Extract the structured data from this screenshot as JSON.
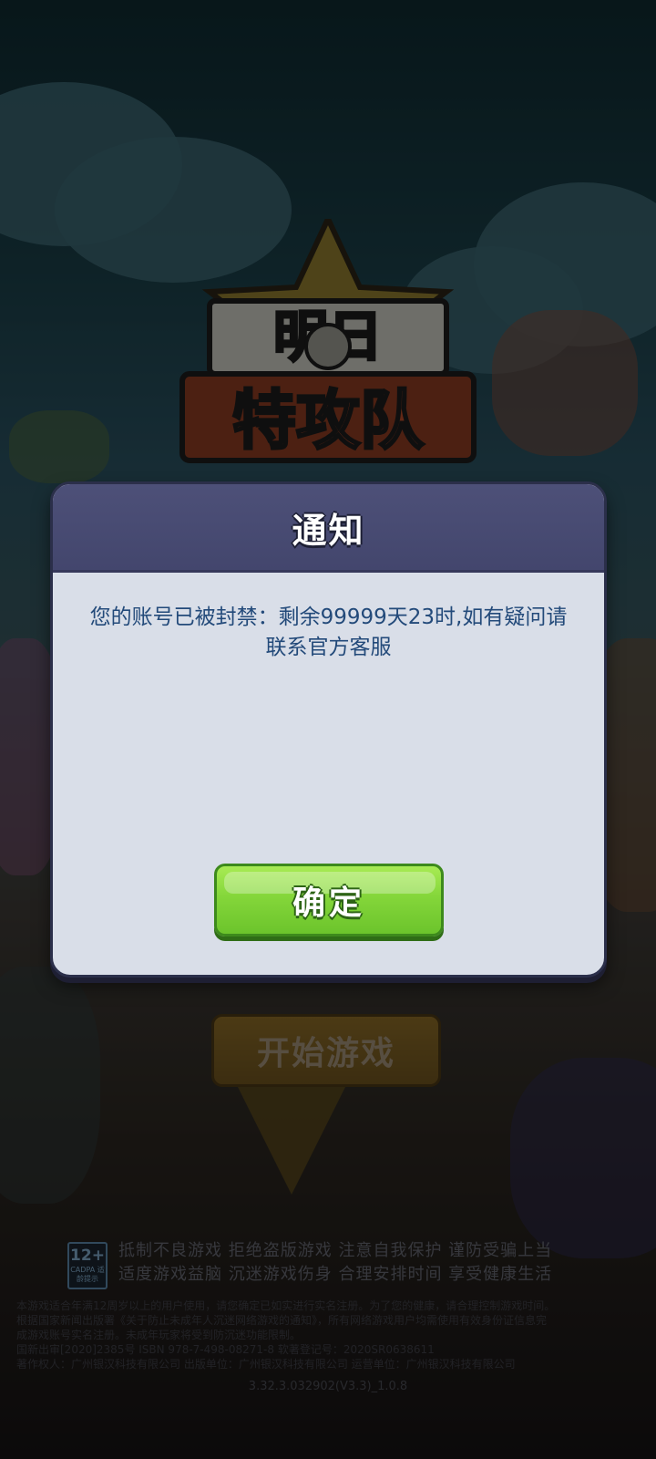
{
  "game": {
    "logo_text_top": "明日",
    "logo_text_bottom": "特攻队",
    "start_button_label": "开始游戏"
  },
  "modal": {
    "title": "通知",
    "message": "您的账号已被封禁：剩余99999天23时,如有疑问请联系官方客服",
    "confirm_label": "确定"
  },
  "footer": {
    "age_badge": "12+",
    "age_badge_sub": "CADPA 适龄提示",
    "health_notice": [
      "抵制不良游戏  拒绝盗版游戏  注意自我保护  谨防受骗上当",
      "适度游戏益脑  沉迷游戏伤身  合理安排时间  享受健康生活"
    ],
    "legal_lines": [
      "本游戏适合年满12周岁以上的用户使用，请您确定已如实进行实名注册。为了您的健康，请合理控制游戏时间。",
      "根据国家新闻出版署《关于防止未成年人沉迷网络游戏的通知》，所有网络游戏用户均需使用有效身份证信息完",
      "成游戏账号实名注册。未成年玩家将受到防沉迷功能限制。",
      "国新出审[2020]2385号    ISBN 978-7-498-08271-8    软著登记号：2020SR0638611",
      "著作权人：广州银汉科技有限公司  出版单位：广州银汉科技有限公司  运营单位：广州银汉科技有限公司"
    ],
    "version": "3.32.3.032902(V3.3)_1.0.8"
  },
  "colors": {
    "header_bg": "#4d5078",
    "modal_bg": "#d9dee8",
    "message_text": "#234a7a",
    "confirm_green": "#84d63a",
    "start_gold": "#8a6a27"
  }
}
